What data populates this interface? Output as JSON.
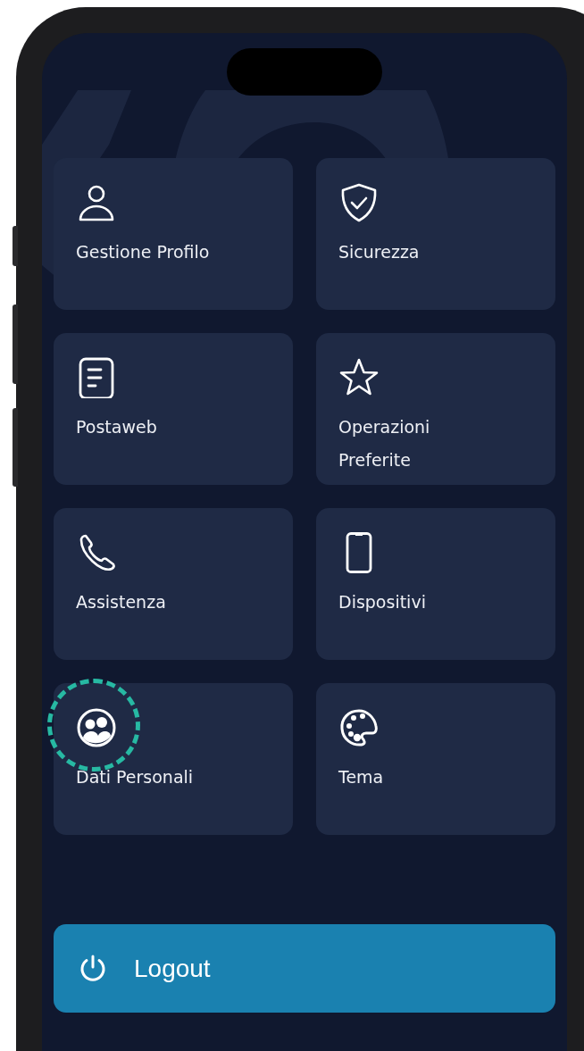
{
  "menu": [
    {
      "label": "Gestione Profilo",
      "kind": "person",
      "highlighted": false
    },
    {
      "label": "Sicurezza",
      "kind": "shield",
      "highlighted": false
    },
    {
      "label": "Postaweb",
      "kind": "document",
      "highlighted": false
    },
    {
      "label": "Operazioni Preferite",
      "kind": "star",
      "highlighted": false
    },
    {
      "label": "Assistenza",
      "kind": "phone",
      "highlighted": false
    },
    {
      "label": "Dispositivi",
      "kind": "smartphone",
      "highlighted": false
    },
    {
      "label": "Dati Personali",
      "kind": "people",
      "highlighted": true
    },
    {
      "label": "Tema",
      "kind": "palette",
      "highlighted": false
    }
  ],
  "logout": {
    "label": "Logout"
  }
}
